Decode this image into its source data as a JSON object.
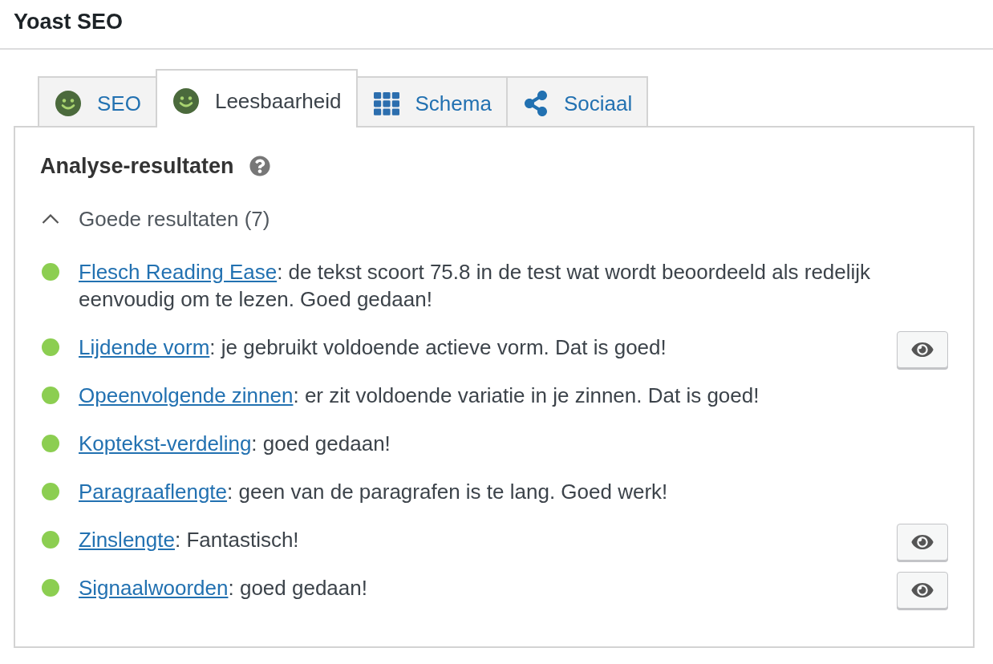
{
  "header": {
    "title": "Yoast SEO"
  },
  "tabs": [
    {
      "label": "SEO",
      "kind": "score",
      "selected": false
    },
    {
      "label": "Leesbaarheid",
      "kind": "score",
      "selected": true
    },
    {
      "label": "Schema",
      "kind": "schema",
      "selected": false
    },
    {
      "label": "Sociaal",
      "kind": "social",
      "selected": false
    }
  ],
  "panel": {
    "title": "Analyse-resultaten",
    "group": {
      "label": "Goede resultaten (7)",
      "expanded": true
    },
    "results": [
      {
        "link": "Flesch Reading Ease",
        "text": ": de tekst scoort 75.8 in de test wat wordt beoordeeld als redelijk eenvoudig om te lezen. Goed gedaan!",
        "color": "#8cce51",
        "marker_button": false
      },
      {
        "link": "Lijdende vorm",
        "text": ": je gebruikt voldoende actieve vorm. Dat is goed!",
        "color": "#8cce51",
        "marker_button": true
      },
      {
        "link": "Opeenvolgende zinnen",
        "text": ": er zit voldoende variatie in je zinnen. Dat is goed!",
        "color": "#8cce51",
        "marker_button": false
      },
      {
        "link": "Koptekst-verdeling",
        "text": ": goed gedaan!",
        "color": "#8cce51",
        "marker_button": false
      },
      {
        "link": "Paragraaflengte",
        "text": ": geen van de paragrafen is te lang. Goed werk!",
        "color": "#8cce51",
        "marker_button": false
      },
      {
        "link": "Zinslengte",
        "text": ": Fantastisch!",
        "color": "#8cce51",
        "marker_button": true
      },
      {
        "link": "Signaalwoorden",
        "text": ": goed gedaan!",
        "color": "#8cce51",
        "marker_button": true
      }
    ]
  }
}
